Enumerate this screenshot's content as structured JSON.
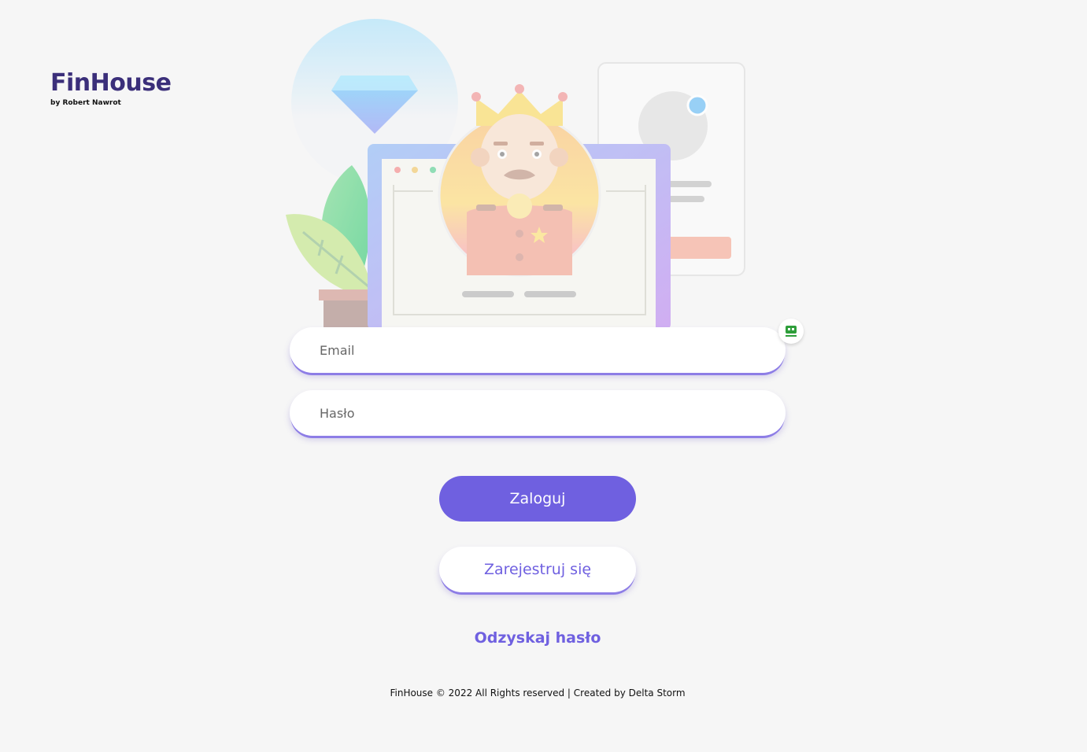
{
  "brand": {
    "title": "FinHouse",
    "subtitle": "by Robert Nawrot"
  },
  "form": {
    "email_placeholder": "Email",
    "email_value": "",
    "password_placeholder": "Hasło",
    "password_value": ""
  },
  "actions": {
    "login_label": "Zaloguj",
    "register_label": "Zarejestruj się",
    "recover_label": "Odzyskaj hasło"
  },
  "footer": {
    "text": "FinHouse © 2022 All Rights reserved | Created by Delta Storm"
  },
  "icons": {
    "password_manager": "password-manager-icon",
    "hero": "king-laptop-illustration"
  },
  "colors": {
    "accent": "#6f60e0",
    "brand": "#3b2f7a",
    "background": "#f6f6f6"
  }
}
